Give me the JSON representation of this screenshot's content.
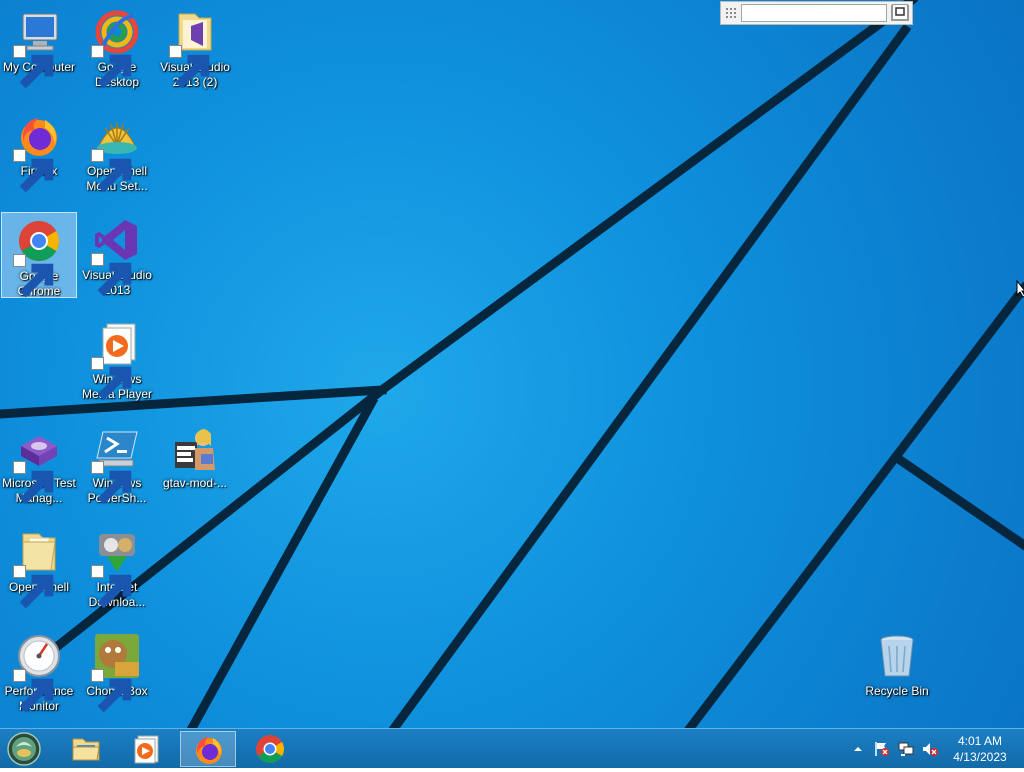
{
  "desktop": {
    "icons": [
      {
        "label": "My Computer"
      },
      {
        "label": "Google Desktop"
      },
      {
        "label": "Visual Studio 2013 (2)"
      },
      {
        "label": "Firefox"
      },
      {
        "label": "Open-Shell Menu Set..."
      },
      {
        "label": "Google Chrome"
      },
      {
        "label": "Visual Studio 2013"
      },
      {
        "label": "Windows Media Player"
      },
      {
        "label": "Microsoft Test Manag..."
      },
      {
        "label": "Windows PowerSh..."
      },
      {
        "label": "gtav-mod-..."
      },
      {
        "label": "Open-Shell"
      },
      {
        "label": "Internet Downloa..."
      },
      {
        "label": "Performance Monitor"
      },
      {
        "label": "ChomikBox"
      },
      {
        "label": "Recycle Bin"
      }
    ]
  },
  "deskband": {
    "value": ""
  },
  "taskbar": {
    "clock_time": "4:01 AM",
    "clock_date": "4/13/2023"
  },
  "colors": {
    "wallpaper": "#0e8fdc",
    "taskbar": "#1b7fc4",
    "selection": "#b4d7f5"
  }
}
